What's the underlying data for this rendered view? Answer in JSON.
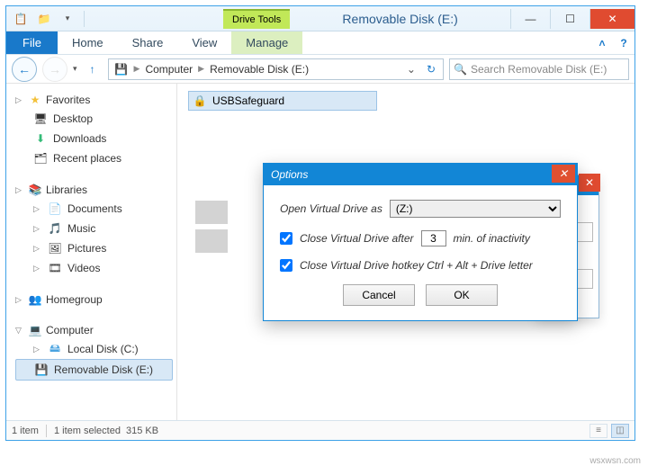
{
  "window": {
    "title": "Removable Disk (E:)",
    "drive_tools_label": "Drive Tools"
  },
  "ribbon": {
    "file": "File",
    "tabs": [
      "Home",
      "Share",
      "View"
    ],
    "manage": "Manage"
  },
  "nav": {
    "back_enabled": true,
    "forward_enabled": false
  },
  "address": {
    "root_icon": "usb",
    "crumbs": [
      "Computer",
      "Removable Disk (E:)"
    ]
  },
  "search": {
    "placeholder": "Search Removable Disk (E:)"
  },
  "sidebar": {
    "favorites": {
      "label": "Favorites",
      "items": [
        {
          "icon": "desktop",
          "label": "Desktop"
        },
        {
          "icon": "down",
          "label": "Downloads"
        },
        {
          "icon": "recent",
          "label": "Recent places"
        }
      ]
    },
    "libraries": {
      "label": "Libraries",
      "items": [
        {
          "icon": "doc",
          "label": "Documents"
        },
        {
          "icon": "music",
          "label": "Music"
        },
        {
          "icon": "pic",
          "label": "Pictures"
        },
        {
          "icon": "video",
          "label": "Videos"
        }
      ]
    },
    "homegroup": {
      "label": "Homegroup"
    },
    "computer": {
      "label": "Computer",
      "items": [
        {
          "icon": "hdd",
          "label": "Local Disk (C:)"
        },
        {
          "icon": "usb",
          "label": "Removable Disk (E:)",
          "selected": true
        }
      ]
    }
  },
  "files": [
    {
      "icon": "safe",
      "name": "USBSafeguard",
      "selected": true
    }
  ],
  "status": {
    "count": "1 item",
    "selection": "1 item selected",
    "size": "315 KB"
  },
  "dialog": {
    "title": "Options",
    "row1_label": "Open Virtual Drive as",
    "row1_value": "(Z:)",
    "row2_label_a": "Close Virtual Drive after",
    "row2_value": "3",
    "row2_label_b": "min. of inactivity",
    "row2_checked": true,
    "row3_label": "Close Virtual Drive hotkey Ctrl + Alt + Drive letter",
    "row3_checked": true,
    "cancel": "Cancel",
    "ok": "OK"
  },
  "watermark": "wsxwsn.com"
}
